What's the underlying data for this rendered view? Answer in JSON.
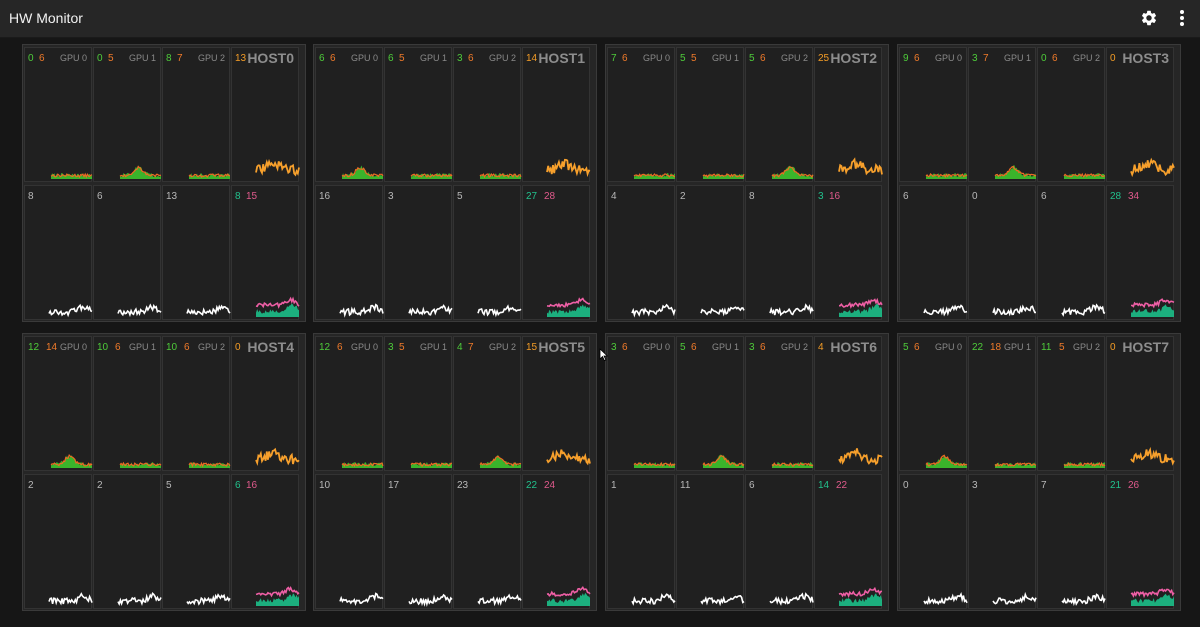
{
  "app": {
    "title": "HW Monitor"
  },
  "icons": {
    "settings": "gear-icon",
    "menu": "more-vert-icon"
  },
  "colors": {
    "gpu_util": "#3fcf2e",
    "gpu_mem": "#ee6a24",
    "cpu": "#f7a02c",
    "system": "#ffffff",
    "net_in": "#1cbf88",
    "net_out": "#ee5fa5",
    "label_gray": "#b8b8b8"
  },
  "hosts": [
    {
      "name": "HOST0",
      "gpus": [
        {
          "label": "GPU 0",
          "util": "0",
          "mem": "6"
        },
        {
          "label": "GPU 1",
          "util": "0",
          "mem": "5"
        },
        {
          "label": "GPU 2",
          "util": "8",
          "mem": "7"
        }
      ],
      "cpu": "13",
      "sys": [
        "8",
        "6",
        "13"
      ],
      "net": {
        "a": "8",
        "b": "15"
      }
    },
    {
      "name": "HOST1",
      "gpus": [
        {
          "label": "GPU 0",
          "util": "6",
          "mem": "6"
        },
        {
          "label": "GPU 1",
          "util": "6",
          "mem": "5"
        },
        {
          "label": "GPU 2",
          "util": "3",
          "mem": "6"
        }
      ],
      "cpu": "14",
      "sys": [
        "16",
        "3",
        "5"
      ],
      "net": {
        "a": "27",
        "b": "28"
      }
    },
    {
      "name": "HOST2",
      "gpus": [
        {
          "label": "GPU 0",
          "util": "7",
          "mem": "6"
        },
        {
          "label": "GPU 1",
          "util": "5",
          "mem": "5"
        },
        {
          "label": "GPU 2",
          "util": "5",
          "mem": "6"
        }
      ],
      "cpu": "25",
      "sys": [
        "4",
        "2",
        "8"
      ],
      "net": {
        "a": "3",
        "b": "16"
      }
    },
    {
      "name": "HOST3",
      "gpus": [
        {
          "label": "GPU 0",
          "util": "9",
          "mem": "6"
        },
        {
          "label": "GPU 1",
          "util": "3",
          "mem": "7"
        },
        {
          "label": "GPU 2",
          "util": "0",
          "mem": "6"
        }
      ],
      "cpu": "0",
      "sys": [
        "6",
        "0",
        "6"
      ],
      "net": {
        "a": "28",
        "b": "34"
      }
    },
    {
      "name": "HOST4",
      "gpus": [
        {
          "label": "GPU 0",
          "util": "12",
          "mem": "14"
        },
        {
          "label": "GPU 1",
          "util": "10",
          "mem": "6"
        },
        {
          "label": "GPU 2",
          "util": "10",
          "mem": "6"
        }
      ],
      "cpu": "0",
      "sys": [
        "2",
        "2",
        "5"
      ],
      "net": {
        "a": "6",
        "b": "16"
      }
    },
    {
      "name": "HOST5",
      "gpus": [
        {
          "label": "GPU 0",
          "util": "12",
          "mem": "6"
        },
        {
          "label": "GPU 1",
          "util": "3",
          "mem": "5"
        },
        {
          "label": "GPU 2",
          "util": "4",
          "mem": "7"
        }
      ],
      "cpu": "15",
      "sys": [
        "10",
        "17",
        "23"
      ],
      "net": {
        "a": "22",
        "b": "24"
      }
    },
    {
      "name": "HOST6",
      "gpus": [
        {
          "label": "GPU 0",
          "util": "3",
          "mem": "6"
        },
        {
          "label": "GPU 1",
          "util": "5",
          "mem": "6"
        },
        {
          "label": "GPU 2",
          "util": "3",
          "mem": "6"
        }
      ],
      "cpu": "4",
      "sys": [
        "1",
        "11",
        "6"
      ],
      "net": {
        "a": "14",
        "b": "22"
      }
    },
    {
      "name": "HOST7",
      "gpus": [
        {
          "label": "GPU 0",
          "util": "5",
          "mem": "6"
        },
        {
          "label": "GPU 1",
          "util": "22",
          "mem": "18"
        },
        {
          "label": "GPU 2",
          "util": "11",
          "mem": "5"
        }
      ],
      "cpu": "0",
      "sys": [
        "0",
        "3",
        "7"
      ],
      "net": {
        "a": "21",
        "b": "26"
      }
    }
  ]
}
